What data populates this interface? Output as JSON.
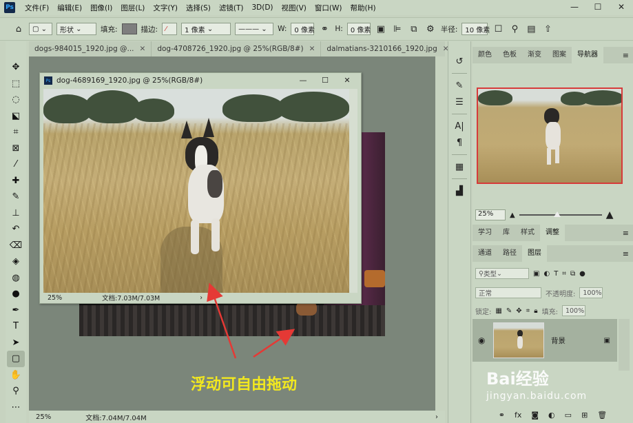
{
  "menu": {
    "items": [
      "文件(F)",
      "编辑(E)",
      "图像(I)",
      "图层(L)",
      "文字(Y)",
      "选择(S)",
      "滤镜(T)",
      "3D(D)",
      "视图(V)",
      "窗口(W)",
      "帮助(H)"
    ],
    "app_icon": "Ps"
  },
  "options": {
    "shape_mode": "形状",
    "fill_label": "填充:",
    "stroke_label": "描边:",
    "stroke_width": "1 像素",
    "w_label": "W:",
    "w_value": "0 像素",
    "h_label": "H:",
    "h_value": "0 像素",
    "radius_label": "半径:",
    "radius_value": "10 像素"
  },
  "tabs": [
    {
      "label": "dogs-984015_1920.jpg @..."
    },
    {
      "label": "dog-4708726_1920.jpg @ 25%(RGB/8#)"
    },
    {
      "label": "dalmatians-3210166_1920.jpg"
    }
  ],
  "float_window": {
    "title": "dog-4689169_1920.jpg @ 25%(RGB/8#)",
    "zoom": "25%",
    "doc_info": "文档:7.03M/7.03M"
  },
  "status": {
    "zoom": "25%",
    "doc_info": "文档:7.04M/7.04M"
  },
  "panels": {
    "top_tabs": [
      "颜色",
      "色板",
      "渐变",
      "图案",
      "导航器"
    ],
    "nav_zoom": "25%",
    "mid_tabs": [
      "学习",
      "库",
      "样式",
      "调整"
    ],
    "layer_tabs": [
      "通道",
      "路径",
      "图层"
    ],
    "kind_label": "类型",
    "blend_mode": "正常",
    "opacity_label": "不透明度:",
    "opacity_value": "100%",
    "lock_label": "锁定:",
    "fill_label": "填充:",
    "fill_value": "100%",
    "layer_name": "背景"
  },
  "annotation": {
    "caption": "浮动可自由拖动"
  },
  "watermark": {
    "brand": "Bai经验",
    "url": "jingyan.baidu.com"
  }
}
